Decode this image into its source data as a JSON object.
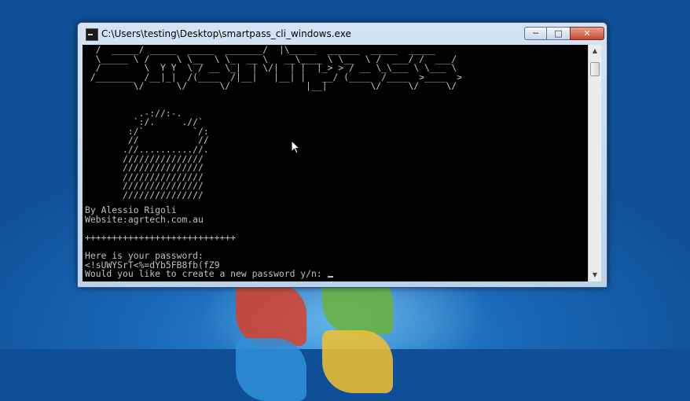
{
  "window": {
    "title": "C:\\Users\\testing\\Desktop\\smartpass_cli_windows.exe",
    "minimize_label": "─",
    "maximize_label": "□",
    "close_label": "✕"
  },
  "console": {
    "banner": "  /  _____/ _____  _____  _______/  |\\_____  ______  _____  _____\n  \\_____ \\ /     \\ \\__  \\ \\_  __ \\   __\\____ \\ \\__  \\ /  ___/ /  ___/\n  /        \\  Y Y  \\ / __ \\_|  | \\/|  | |  |_> > / __ \\_\\___ \\ \\___ \\\n /_______  /__|_|  /(____  /|__|   |__| |   __/ (____  /____  >____  >\n         \\/      \\/      \\/              |__|        \\/     \\/     \\/",
    "lock": "\n          .-://:-.\n         `:/.     .//`\n        :/`         `/:\n        //           //\n       .//..........//.\n       ///////////////\n       ///////////////\n       ///////////////\n       ///////////////\n       ///////////////",
    "author": "By Alessio Rigoli",
    "website": "Website:agrtech.com.au",
    "separator": "++++++++++++++++++++++++++++",
    "password_heading": "Here is your password:",
    "password": "<!sUWYSrT<%=dYb5FB8fb(fZ9",
    "prompt": "Would you like to create a new password y/n: "
  },
  "colors": {
    "console_bg": "#000000",
    "console_text": "#c0c0c0",
    "close_button": "#c74a32"
  },
  "icons": {
    "app": "console-app-icon",
    "scroll_up": "scroll-up-arrow-icon",
    "scroll_down": "scroll-down-arrow-icon",
    "pointer": "mouse-pointer-icon"
  }
}
